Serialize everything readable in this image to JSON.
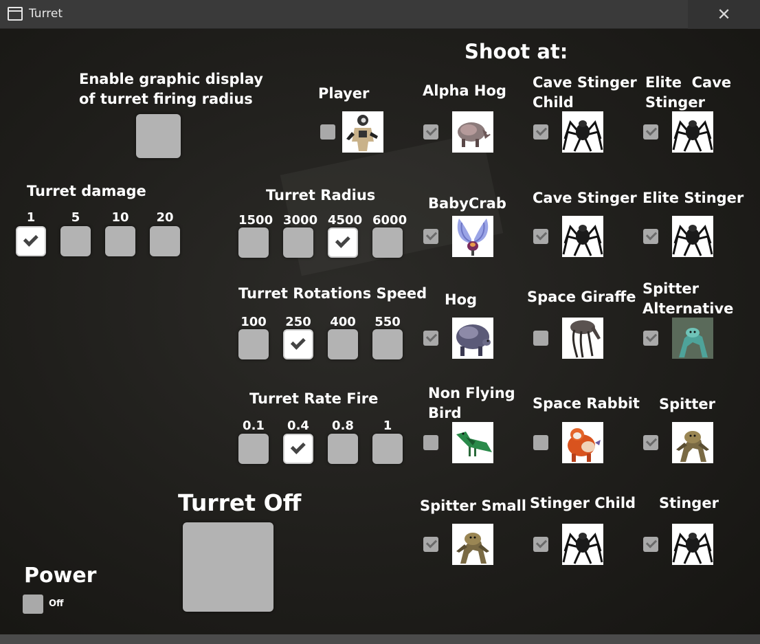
{
  "window": {
    "title": "Turret",
    "close_icon": "✕"
  },
  "graphic_display": {
    "label": "Enable graphic display\nof turret firing radius",
    "checked": false
  },
  "damage": {
    "title": "Turret damage",
    "options": [
      {
        "label": "1",
        "checked": true
      },
      {
        "label": "5",
        "checked": false
      },
      {
        "label": "10",
        "checked": false
      },
      {
        "label": "20",
        "checked": false
      }
    ]
  },
  "radius": {
    "title": "Turret Radius",
    "options": [
      {
        "label": "1500",
        "checked": false
      },
      {
        "label": "3000",
        "checked": false
      },
      {
        "label": "4500",
        "checked": true
      },
      {
        "label": "6000",
        "checked": false
      }
    ]
  },
  "rotation": {
    "title": "Turret Rotations Speed",
    "options": [
      {
        "label": "100",
        "checked": false
      },
      {
        "label": "250",
        "checked": true
      },
      {
        "label": "400",
        "checked": false
      },
      {
        "label": "550",
        "checked": false
      }
    ]
  },
  "rate": {
    "title": "Turret Rate Fire",
    "options": [
      {
        "label": "0.1",
        "checked": false
      },
      {
        "label": "0.4",
        "checked": true
      },
      {
        "label": "0.8",
        "checked": false
      },
      {
        "label": "1",
        "checked": false
      }
    ]
  },
  "turret_state": {
    "label": "Turret Off"
  },
  "power": {
    "title": "Power",
    "state_label": "Off"
  },
  "shoot_at": {
    "title": "Shoot at:",
    "targets": [
      {
        "name": "Player",
        "checked": false,
        "icon": "player-icon"
      },
      {
        "name": "Alpha Hog",
        "checked": true,
        "icon": "alpha-hog-icon"
      },
      {
        "name": "Cave Stinger\nChild",
        "checked": true,
        "icon": "spider-icon"
      },
      {
        "name": "Elite  Cave\nStinger",
        "checked": true,
        "icon": "spider-icon"
      },
      {
        "name": "BabyCrab",
        "checked": true,
        "icon": "babycrab-icon"
      },
      {
        "name": "Cave Stinger",
        "checked": true,
        "icon": "spider-icon"
      },
      {
        "name": "Elite Stinger",
        "checked": true,
        "icon": "spider-icon"
      },
      {
        "name": "Hog",
        "checked": true,
        "icon": "hog-icon"
      },
      {
        "name": "Space Giraffe",
        "checked": false,
        "icon": "giraffe-icon"
      },
      {
        "name": "Spitter\nAlternative",
        "checked": true,
        "icon": "spitter-alt-icon"
      },
      {
        "name": "Non Flying\nBird",
        "checked": false,
        "icon": "bird-icon"
      },
      {
        "name": "Space Rabbit",
        "checked": false,
        "icon": "rabbit-icon"
      },
      {
        "name": "Spitter",
        "checked": true,
        "icon": "spitter-icon"
      },
      {
        "name": "Spitter Small",
        "checked": true,
        "icon": "spitter-icon"
      },
      {
        "name": "Stinger Child",
        "checked": true,
        "icon": "spider-icon"
      },
      {
        "name": "Stinger",
        "checked": true,
        "icon": "spider-icon"
      }
    ]
  }
}
